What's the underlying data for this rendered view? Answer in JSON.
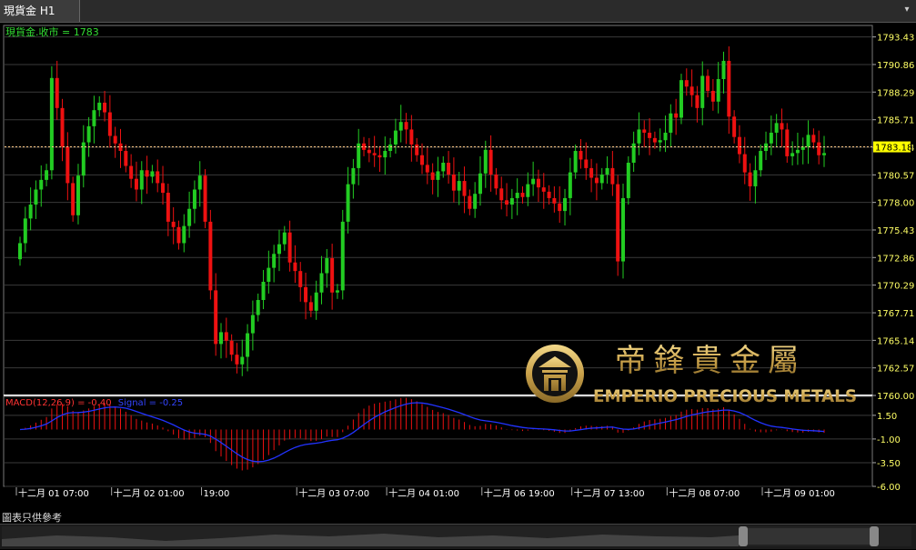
{
  "tab": {
    "title": "現貨金 H1",
    "menu_glyph": "▾"
  },
  "legend": {
    "price": "現貨金.收市 = 1783",
    "macd": "MACD(12,26,9) = -0.40",
    "signal": "Signal = -0.25"
  },
  "logo": {
    "chinese": "帝鋒貴金屬",
    "english": "EMPERIO PRECIOUS METALS"
  },
  "disclaimer": "圖表只供參考",
  "colors": {
    "up": "#22cc22",
    "down": "#ee1111",
    "signal": "#2233ff",
    "axis_text": "#ffff66",
    "current": "#ffff00"
  },
  "chart_data": [
    {
      "type": "candlestick",
      "series_name": "現貨金.收市",
      "current_price": 1783.18,
      "y_ticks": [
        1793.43,
        1790.86,
        1788.29,
        1785.71,
        1783.14,
        1780.57,
        1778.0,
        1775.43,
        1772.86,
        1770.29,
        1767.71,
        1765.14,
        1762.57,
        1760.0
      ],
      "ylim": [
        1760.0,
        1794.5
      ],
      "x_tick_labels": [
        "十二月 01 07:00",
        "十二月 02 01:00",
        "19:00",
        "十二月 03 07:00",
        "十二月 04 01:00",
        "十二月 06 19:00",
        "十二月 07 13:00",
        "十二月 08 07:00",
        "十二月 09 01:00"
      ],
      "closes": [
        1774.2,
        1776.5,
        1777.8,
        1779.2,
        1780.1,
        1781.0,
        1789.6,
        1786.8,
        1783.2,
        1779.8,
        1776.8,
        1780.5,
        1783.6,
        1785.1,
        1786.6,
        1787.3,
        1786.4,
        1784.2,
        1783.5,
        1782.8,
        1781.4,
        1780.2,
        1779.2,
        1781.0,
        1780.4,
        1780.9,
        1779.8,
        1778.9,
        1776.2,
        1775.7,
        1774.2,
        1775.8,
        1777.4,
        1779.2,
        1780.5,
        1776.2,
        1769.8,
        1764.8,
        1765.9,
        1765.1,
        1763.8,
        1762.9,
        1763.6,
        1765.8,
        1767.5,
        1768.9,
        1770.6,
        1771.9,
        1773.2,
        1774.1,
        1775.2,
        1772.4,
        1771.6,
        1770.1,
        1768.7,
        1767.9,
        1769.6,
        1771.4,
        1772.8,
        1769.6,
        1769.8,
        1776.2,
        1779.7,
        1781.2,
        1783.5,
        1782.9,
        1782.6,
        1782.4,
        1782.2,
        1782.8,
        1783.4,
        1784.7,
        1785.5,
        1784.8,
        1783.4,
        1782.4,
        1781.5,
        1780.8,
        1780.1,
        1780.9,
        1781.7,
        1780.6,
        1779.1,
        1780.0,
        1778.6,
        1777.4,
        1778.8,
        1780.7,
        1782.9,
        1780.6,
        1779.3,
        1778.2,
        1777.8,
        1778.4,
        1778.9,
        1778.5,
        1779.7,
        1780.2,
        1779.4,
        1779.0,
        1778.4,
        1777.9,
        1777.2,
        1778.4,
        1780.8,
        1782.8,
        1782.0,
        1781.2,
        1780.3,
        1779.8,
        1780.6,
        1781.2,
        1779.7,
        1772.5,
        1778.4,
        1781.7,
        1783.5,
        1784.8,
        1784.5,
        1784.0,
        1783.6,
        1783.8,
        1784.5,
        1786.3,
        1785.9,
        1789.4,
        1788.8,
        1788.0,
        1786.8,
        1789.8,
        1788.4,
        1787.4,
        1789.5,
        1791.2,
        1786.0,
        1784.1,
        1782.5,
        1780.8,
        1779.5,
        1781.0,
        1782.8,
        1783.5,
        1784.5,
        1785.4,
        1784.8,
        1782.3,
        1782.6,
        1782.9,
        1783.2,
        1784.3,
        1783.6,
        1782.4,
        1782.6
      ]
    },
    {
      "type": "macd",
      "params": "12,26,9",
      "macd_value": -0.4,
      "signal_value": -0.25,
      "y_ticks": [
        1.5,
        -1.0,
        -3.5,
        -6.0
      ],
      "ylim": [
        -6.0,
        3.5
      ]
    }
  ]
}
